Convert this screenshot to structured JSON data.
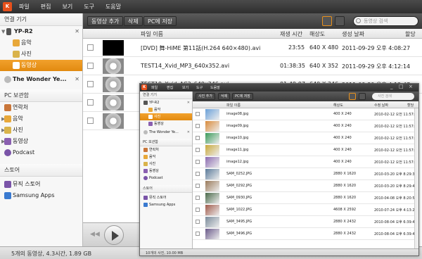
{
  "menu": [
    "파일",
    "편집",
    "보기",
    "도구",
    "도움말"
  ],
  "toolbar": {
    "add_video": "동영상 추가",
    "delete": "삭제",
    "save_to_pc": "PC에 저장",
    "search_placeholder": "동영상 검색"
  },
  "sidebar": {
    "connected_devices": "연결 기기",
    "device_name": "YP-R2",
    "device_items": [
      "음악",
      "사진",
      "동영상"
    ],
    "second_device": "The Wonder Ye...",
    "pc_storage": "PC 보관함",
    "pc_items": [
      "연락처",
      "음악",
      "사진",
      "동영상",
      "Podcast"
    ],
    "store": "스토어",
    "store_items": [
      "뮤직 스토어",
      "Samsung Apps"
    ]
  },
  "table": {
    "headers": [
      "파일 이름",
      "재생 시간",
      "해상도",
      "생성 날짜",
      "할당"
    ],
    "rows": [
      {
        "name": "[DVD] 舞-HiME 第11話(H.264 640×480).avi",
        "duration": "23:55",
        "resolution": "640 X 480",
        "date": "2011-09-29 오후 4:08:27"
      },
      {
        "name": "TEST14_Xvid_MP3_640x352.avi",
        "duration": "01:38:35",
        "resolution": "640 X 352",
        "date": "2011-09-29 오후 4:12:14"
      },
      {
        "name": "TEST19_Xvid_AC3_640x346.avi",
        "duration": "01:49:07",
        "resolution": "640 X 346",
        "date": "2011-09-29 오후 4:12:47"
      }
    ]
  },
  "status": "5개의 동영상, 4.3시간, 1.89 GB",
  "inset": {
    "menu": [
      "파일",
      "편집",
      "보기",
      "도구",
      "도움말"
    ],
    "window_controls": [
      "_",
      "□",
      "×"
    ],
    "toolbar": {
      "add_photo": "사진 추가",
      "delete": "삭제",
      "save_to_pc": "PC에 저장",
      "search_placeholder": "사진 검색"
    },
    "sidebar": {
      "connected_devices": "연결 기기",
      "device_name": "YP-R2",
      "device_items": [
        "음악",
        "사진",
        "동영상"
      ],
      "second_device": "The Wonder Ye...",
      "pc_storage": "PC 보관함",
      "pc_items": [
        "연락처",
        "음악",
        "사진",
        "동영상",
        "Podcast"
      ],
      "store": "스토어",
      "store_items": [
        "뮤직 스토어",
        "Samsung Apps"
      ]
    },
    "headers": [
      "파일 이름",
      "해상도",
      "수정 날짜",
      "할당"
    ],
    "rows": [
      {
        "name": "image08.jpg",
        "resolution": "400 X 240",
        "date": "2010-02-12 오전 11:57:50"
      },
      {
        "name": "image09.jpg",
        "resolution": "400 X 240",
        "date": "2010-02-12 오전 11:57:48"
      },
      {
        "name": "image10.jpg",
        "resolution": "400 X 240",
        "date": "2010-02-12 오전 11:57:36"
      },
      {
        "name": "image11.jpg",
        "resolution": "400 X 240",
        "date": "2010-02-12 오전 11:57:28"
      },
      {
        "name": "image12.jpg",
        "resolution": "400 X 240",
        "date": "2010-02-12 오전 11:57:22"
      },
      {
        "name": "SAM_0252.JPG",
        "resolution": "2880 X 1620",
        "date": "2010-03-20 오후 8:29:32"
      },
      {
        "name": "SAM_0292.JPG",
        "resolution": "2880 X 1620",
        "date": "2010-03-20 오후 8:29:48"
      },
      {
        "name": "SAM_0930.JPG",
        "resolution": "2880 X 1620",
        "date": "2010-04-08 오후 8:20:54"
      },
      {
        "name": "SAM_1022.JPG",
        "resolution": "4608 X 2592",
        "date": "2010-07-24 오후 4:13:24"
      },
      {
        "name": "SAM_3495.JPG",
        "resolution": "2880 X 2432",
        "date": "2010-08-04 오후 6:39:45"
      },
      {
        "name": "SAM_3496.JPG",
        "resolution": "2880 X 2432",
        "date": "2010-08-04 오후 6:39:47"
      }
    ],
    "status": "10개의 사진, 10.00 MB"
  },
  "colors": {
    "accent": "#e8901b",
    "chrome": "#3a3a3a"
  }
}
